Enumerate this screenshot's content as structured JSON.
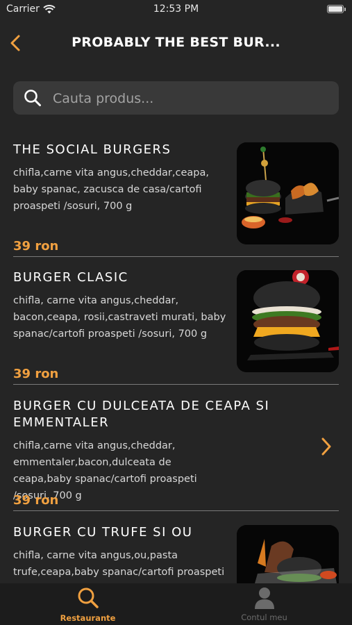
{
  "status_bar": {
    "carrier": "Carrier",
    "time": "12:53 PM"
  },
  "nav": {
    "title": "PROBABLY THE BEST BUR..."
  },
  "search": {
    "placeholder": "Cauta produs..."
  },
  "products": [
    {
      "name": "THE SOCIAL BURGERS",
      "description": "chifla,carne vita angus,cheddar,ceapa, baby spanac, zacusca de casa/cartofi proaspeti /sosuri, 700 g",
      "price": "39 ron",
      "has_image": true
    },
    {
      "name": "BURGER CLASIC",
      "description": "chifla, carne vita angus,cheddar, bacon,ceapa, rosii,castraveti murati, baby spanac/cartofi proaspeti /sosuri, 700 g",
      "price": "39 ron",
      "has_image": true
    },
    {
      "name": "BURGER CU DULCEATA DE CEAPA SI EMMENTALER",
      "description": "chifla,carne vita angus,cheddar, emmentaler,bacon,dulceata de ceapa,baby spanac/cartofi proaspeti /sosuri, 700 g",
      "price": "39 ron",
      "has_image": false
    },
    {
      "name": "BURGER CU TRUFE SI OU",
      "description": "chifla, carne vita angus,ou,pasta trufe,ceapa,baby spanac/cartofi proaspeti",
      "price": "",
      "has_image": true
    }
  ],
  "tabbar": {
    "items": [
      {
        "label": "Restaurante",
        "icon": "search-icon",
        "active": true
      },
      {
        "label": "Contul meu",
        "icon": "user-icon",
        "active": false
      }
    ]
  },
  "colors": {
    "accent": "#f0a040",
    "background": "#252525",
    "search_bg": "#393939",
    "tabbar_bg": "#1c1c1c",
    "inactive": "#6b6b6b"
  }
}
